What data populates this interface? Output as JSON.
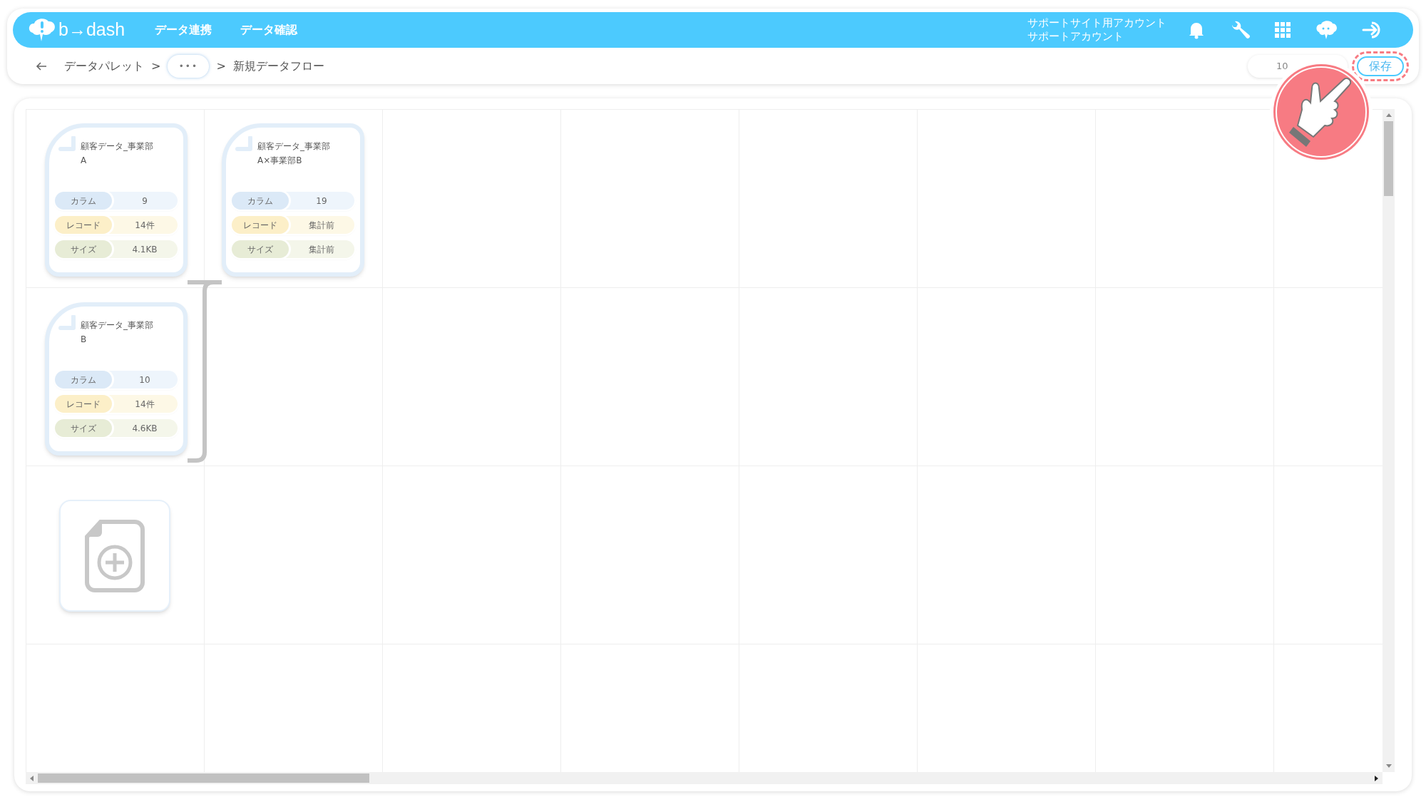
{
  "header": {
    "logo": "b→dash",
    "nav": [
      {
        "label": "データ連携"
      },
      {
        "label": "データ確認"
      }
    ],
    "account": [
      "サポートサイト用アカウント",
      "サポートアカウント"
    ]
  },
  "breadcrumb": {
    "separator": ">",
    "items": [
      {
        "kind": "link",
        "label": "データパレット"
      },
      {
        "kind": "more",
        "label": "•••"
      },
      {
        "kind": "current",
        "label": "新規データフロー"
      }
    ]
  },
  "zoom_field": {
    "value": "10"
  },
  "save_button": {
    "label": "保存",
    "highlighted": true
  },
  "nodes": [
    {
      "title": [
        "顧客データ_事業部",
        "A"
      ],
      "stats": [
        {
          "kind": "columns",
          "label": "カラム",
          "value": "9"
        },
        {
          "kind": "records",
          "label": "レコード",
          "value": "14件"
        },
        {
          "kind": "size",
          "label": "サイズ",
          "value": "4.1KB"
        }
      ]
    },
    {
      "title": [
        "顧客データ_事業部",
        "B"
      ],
      "stats": [
        {
          "kind": "columns",
          "label": "カラム",
          "value": "10"
        },
        {
          "kind": "records",
          "label": "レコード",
          "value": "14件"
        },
        {
          "kind": "size",
          "label": "サイズ",
          "value": "4.6KB"
        }
      ]
    },
    {
      "title": [
        "顧客データ_事業部",
        "A×事業部B"
      ],
      "stats": [
        {
          "kind": "columns",
          "label": "カラム",
          "value": "19"
        },
        {
          "kind": "records",
          "label": "レコード",
          "value": "集計前"
        },
        {
          "kind": "size",
          "label": "サイズ",
          "value": "集計前"
        }
      ]
    }
  ]
}
